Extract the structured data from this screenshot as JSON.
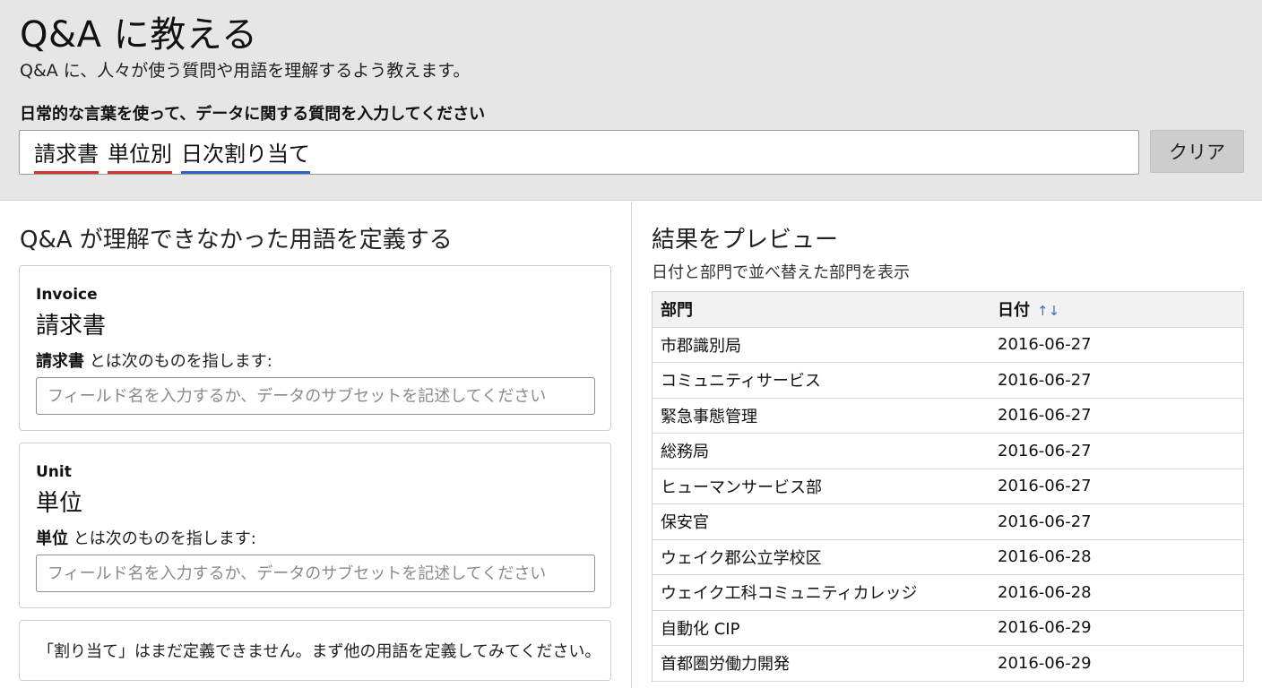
{
  "header": {
    "title": "Q&A に教える",
    "subtitle": "Q&A に、人々が使う質問や用語を理解するよう教えます。",
    "prompt": "日常的な言葉を使って、データに関する質問を入力してください",
    "query_tokens": [
      "請求書",
      "単位別",
      "日次割り当て"
    ],
    "clear_label": "クリア",
    "colors": {
      "token_unknown": "#d0342c",
      "token_partial": "#2c63c4"
    }
  },
  "left": {
    "section_title": "Q&A が理解できなかった用語を定義する",
    "cards": [
      {
        "term_en": "Invoice",
        "term_jp": "請求書",
        "def_term": "請求書",
        "def_suffix": " とは次のものを指します:",
        "placeholder": "フィールド名を入力するか、データのサブセットを記述してください",
        "value": ""
      },
      {
        "term_en": "Unit",
        "term_jp": "単位",
        "def_term": "単位",
        "def_suffix": " とは次のものを指します:",
        "placeholder": "フィールド名を入力するか、データのサブセットを記述してください",
        "value": ""
      }
    ],
    "note": "「割り当て」はまだ定義できません。まず他の用語を定義してみてください。"
  },
  "preview": {
    "title": "結果をプレビュー",
    "subtitle": "日付と部門で並べ替えた部門を表示",
    "columns": [
      "部門",
      "日付"
    ],
    "sort_icon": "sort-arrows-icon",
    "rows": [
      [
        "市郡識別局",
        "2016-06-27"
      ],
      [
        "コミュニティサービス",
        "2016-06-27"
      ],
      [
        "緊急事態管理",
        "2016-06-27"
      ],
      [
        "総務局",
        "2016-06-27"
      ],
      [
        "ヒューマンサービス部",
        "2016-06-27"
      ],
      [
        "保安官",
        "2016-06-27"
      ],
      [
        "ウェイク郡公立学校区",
        "2016-06-28"
      ],
      [
        "ウェイク工科コミュニティカレッジ",
        "2016-06-28"
      ],
      [
        "自動化 CIP",
        "2016-06-29"
      ],
      [
        "首都圏労働力開発",
        "2016-06-29"
      ]
    ]
  }
}
